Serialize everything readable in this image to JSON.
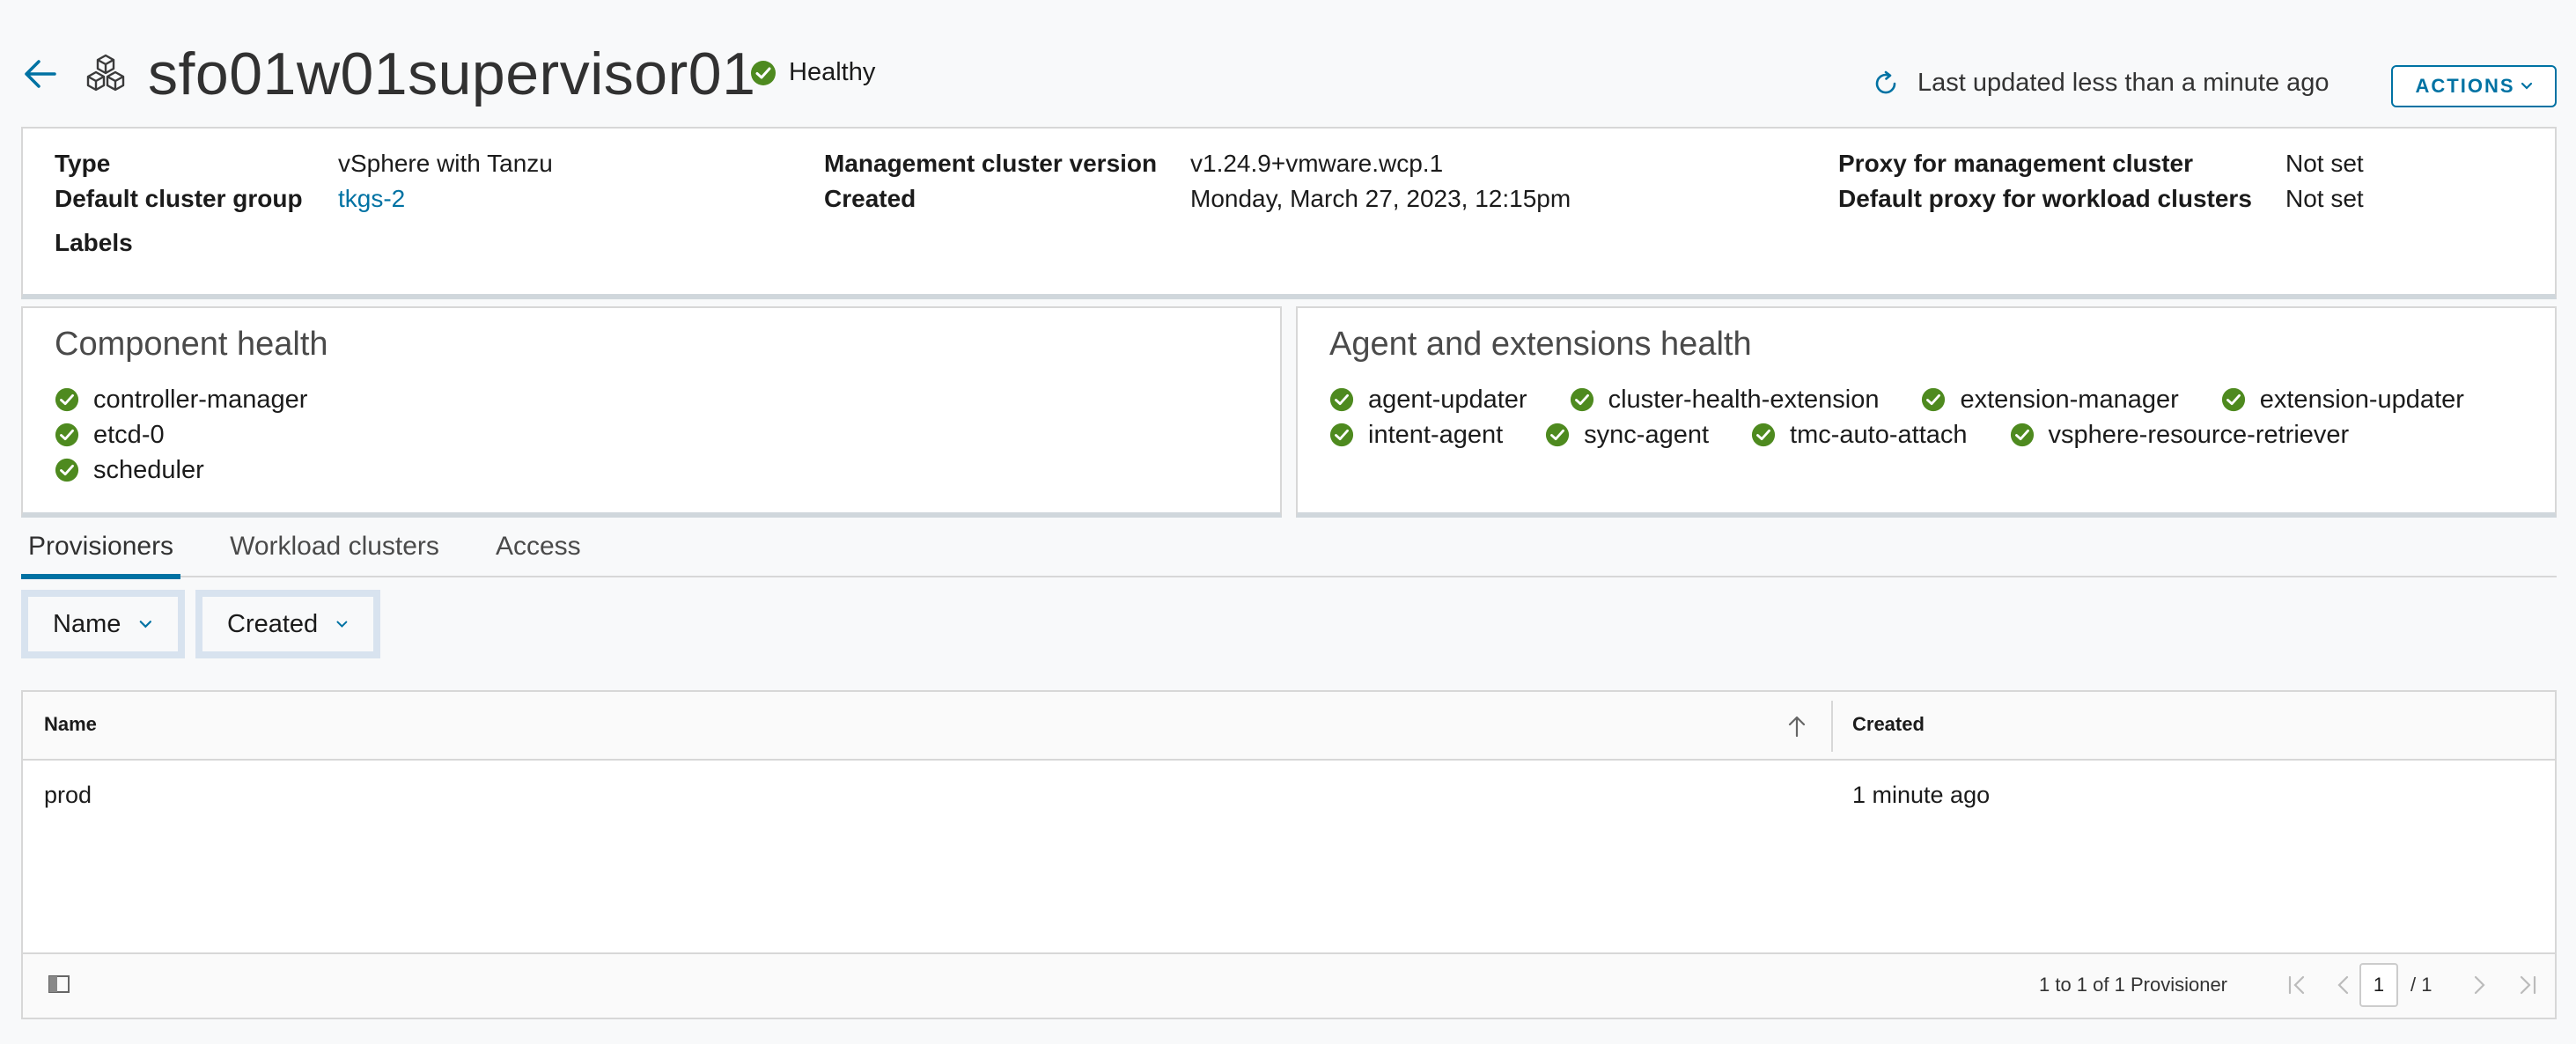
{
  "header": {
    "title": "sfo01w01supervisor01",
    "status": "Healthy",
    "last_updated": "Last updated less than a minute ago",
    "actions_label": "ACTIONS"
  },
  "info": {
    "type_label": "Type",
    "type_value": "vSphere with Tanzu",
    "group_label": "Default cluster group",
    "group_value": "tkgs-2",
    "labels_label": "Labels",
    "mgmt_version_label": "Management cluster version",
    "mgmt_version_value": "v1.24.9+vmware.wcp.1",
    "created_label": "Created",
    "created_value": "Monday, March 27, 2023, 12:15pm",
    "proxy_mgmt_label": "Proxy for management cluster",
    "proxy_mgmt_value": "Not set",
    "proxy_workload_label": "Default proxy for workload clusters",
    "proxy_workload_value": "Not set"
  },
  "component_health": {
    "title": "Component health",
    "items": [
      "controller-manager",
      "etcd-0",
      "scheduler"
    ]
  },
  "agent_health": {
    "title": "Agent and extensions health",
    "row1": [
      "agent-updater",
      "cluster-health-extension",
      "extension-manager",
      "extension-updater"
    ],
    "row2": [
      "intent-agent",
      "sync-agent",
      "tmc-auto-attach",
      "vsphere-resource-retriever"
    ]
  },
  "tabs": [
    "Provisioners",
    "Workload clusters",
    "Access"
  ],
  "filters": [
    "Name",
    "Created"
  ],
  "table": {
    "columns": [
      "Name",
      "Created"
    ],
    "rows": [
      {
        "name": "prod",
        "created": "1 minute ago"
      }
    ],
    "pagination_text": "1 to 1 of 1 Provisioner",
    "current_page": "1",
    "total_pages": "/ 1"
  },
  "colors": {
    "accent": "#0072a3",
    "success": "#4e8a1f"
  }
}
